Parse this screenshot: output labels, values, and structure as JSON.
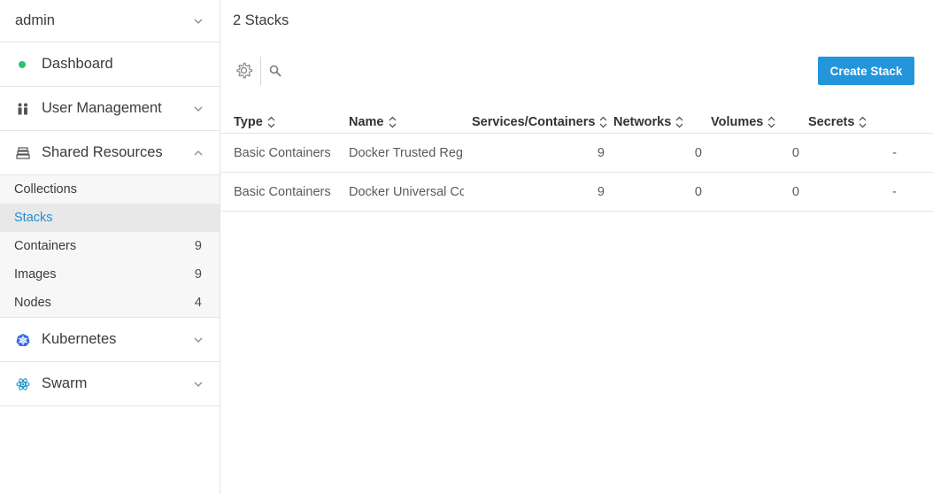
{
  "sidebar": {
    "user": {
      "label": "admin",
      "icon": "chevron-down-icon"
    },
    "dashboard": {
      "label": "Dashboard",
      "icon": "status-dot-icon",
      "dot_color": "#2fbf71"
    },
    "user_management": {
      "label": "User Management",
      "icon": "users-icon"
    },
    "shared_resources": {
      "label": "Shared Resources",
      "icon": "shared-resources-icon",
      "items": [
        {
          "label": "Collections",
          "count": ""
        },
        {
          "label": "Stacks",
          "count": ""
        },
        {
          "label": "Containers",
          "count": "9"
        },
        {
          "label": "Images",
          "count": "9"
        },
        {
          "label": "Nodes",
          "count": "4"
        }
      ]
    },
    "kubernetes": {
      "label": "Kubernetes",
      "icon": "kubernetes-icon"
    },
    "swarm": {
      "label": "Swarm",
      "icon": "swarm-icon"
    }
  },
  "main": {
    "title": "2 Stacks",
    "create_button": "Create Stack",
    "columns": [
      "Type",
      "Name",
      "Services/Containers",
      "Networks",
      "Volumes",
      "Secrets"
    ],
    "rows": [
      {
        "type": "Basic Containers",
        "name": "Docker Trusted Regi",
        "services": "9",
        "networks": "0",
        "volumes": "0",
        "secrets": "-"
      },
      {
        "type": "Basic Containers",
        "name": "Docker Universal Cc",
        "services": "9",
        "networks": "0",
        "volumes": "0",
        "secrets": "-"
      }
    ]
  },
  "colors": {
    "accent": "#2295db",
    "active_link": "#1f8fd3",
    "active_bg": "#e8e8e8"
  }
}
